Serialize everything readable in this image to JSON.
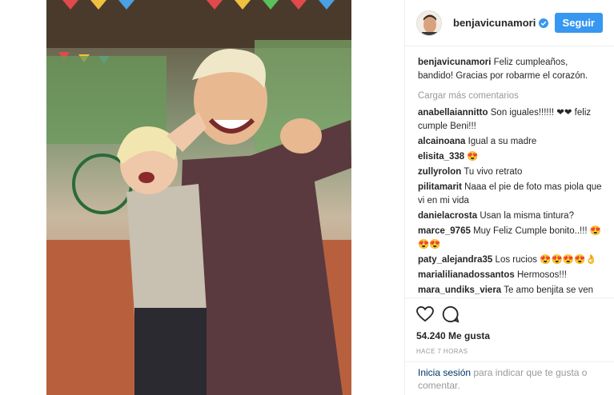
{
  "post": {
    "username": "benjavicunamori",
    "follow_label": "Seguir",
    "caption": {
      "user": "benjavicunamori",
      "text": "Feliz cumpleaños, bandido! Gracias por robarme el corazón."
    },
    "load_more": "Cargar más comentarios",
    "comments": [
      {
        "user": "anabellaiannitto",
        "text": "Son iguales!!!!!! ❤❤ feliz cumple Beni!!!"
      },
      {
        "user": "alcainoana",
        "text": "Igual a su madre"
      },
      {
        "user": "elisita_338",
        "text": "😍"
      },
      {
        "user": "zullyrolon",
        "text": "Tu vivo retrato"
      },
      {
        "user": "pilitamarit",
        "text": "Naaa el pie de foto mas piola que vi en mi vida"
      },
      {
        "user": "danielacrosta",
        "text": "Usan la misma tintura?"
      },
      {
        "user": "marce_9765",
        "text": "Muy Feliz Cumple bonito..!!! 😍😍😍"
      },
      {
        "user": "paty_alejandra35",
        "text": "Los rucios 😍😍😍😍👌"
      },
      {
        "user": "marialilianadossantos",
        "text": "Hermosos!!!"
      },
      {
        "user": "mara_undiks_viera",
        "text": "Te amo benjita se ven"
      }
    ],
    "likes": "54.240 Me gusta",
    "time_ago": "HACE 7 HORAS",
    "login_link": "Inicia sesión",
    "login_text": " para indicar que te gusta o comentar."
  },
  "colors": {
    "accent": "#3897f0",
    "link": "#003569",
    "muted": "#999999"
  },
  "icons": {
    "verified": "verified-badge-icon",
    "like": "heart-icon",
    "comment": "comment-bubble-icon"
  }
}
